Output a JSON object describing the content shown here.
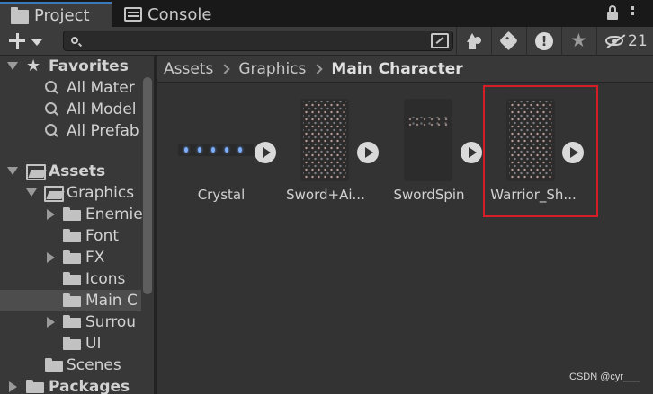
{
  "tabs": [
    {
      "label": "Project",
      "icon": "folder-icon",
      "active": true
    },
    {
      "label": "Console",
      "icon": "console-icon",
      "active": false
    }
  ],
  "toolbar": {
    "add_icon": "plus-icon",
    "search_value": "",
    "hidden_count": "21"
  },
  "tree": {
    "favorites_label": "Favorites",
    "favorites": [
      "All Mater",
      "All Model",
      "All Prefab"
    ],
    "assets_label": "Assets",
    "graphics_label": "Graphics",
    "graphics_children": [
      "Enemie",
      "Font",
      "FX",
      "Icons",
      "Main C",
      "Surrou",
      "UI"
    ],
    "scenes_label": "Scenes",
    "packages_label": "Packages"
  },
  "breadcrumb": [
    "Assets",
    "Graphics",
    "Main Character"
  ],
  "assets": [
    {
      "name": "Crystal",
      "type": "sprite-strip"
    },
    {
      "name": "Sword+Ai...",
      "type": "sprite-sheet"
    },
    {
      "name": "SwordSpin",
      "type": "sprite-sheet"
    },
    {
      "name": "Warrior_Sh...",
      "type": "sprite-sheet",
      "highlighted": true
    }
  ],
  "colors": {
    "accent_tab": "#3a79bb",
    "highlight_box": "#d41d26",
    "panel_bg": "#383838",
    "grid_bg": "#333333"
  },
  "watermark": "CSDN @cyr___"
}
